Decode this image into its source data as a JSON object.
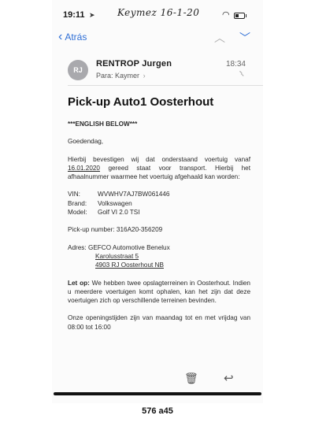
{
  "status_bar": {
    "time": "19:11",
    "handwritten_note": "Keymez 16-1-20",
    "icons": [
      "location-icon",
      "wifi-icon",
      "battery-icon"
    ]
  },
  "nav": {
    "back_label": "Atrás",
    "icons": [
      "chevron-left-icon",
      "chevron-up-icon",
      "chevron-down-icon"
    ]
  },
  "message": {
    "avatar_initials": "RJ",
    "sender": "RENTROP Jurgen",
    "recipient_prefix": "Para:",
    "recipient_name": "Kaymer",
    "time": "18:34",
    "subject": "Pick-up Auto1 Oosterhout",
    "body": {
      "english_below": "***ENGLISH BELOW***",
      "greeting": "Goedendag,",
      "intro_before_date": "Hierbij bevestigen wij dat onderstaand voertuig vanaf",
      "pickup_date": "16.01.2020",
      "intro_after_date": "gereed staat voor transport. Hierbij het afhaalnummer waarmee het voertuig afgehaald kan worden:",
      "vin_label": "VIN:",
      "vin_value": "WVWHV7AJ7BW061446",
      "brand_label": "Brand:",
      "brand_value": "Volkswagen",
      "model_label": "Model:",
      "model_value": "Golf VI 2.0 TSI",
      "pickup_number_label": "Pick-up number:",
      "pickup_number_value": "316A20-356209",
      "address_label": "Adres:",
      "address_line1": "GEFCO Automotive Benelux",
      "address_line2": "Karolusstraat 5",
      "address_line3": "4903 RJ Oosterhout NB",
      "note_label": "Let op:",
      "note_text": "We hebben twee opslagterreinen in Oosterhout. Indien u meerdere voertuigen komt ophalen, kan het zijn dat deze voertuigen zich op verschillende terreinen bevinden.",
      "hours_text": "Onze openingstijden zijn van maandag tot en met vrijdag van 08:00 tot 16:00"
    }
  },
  "toolbar": {
    "icons": [
      "trash-icon",
      "reply-icon"
    ]
  },
  "page_stamp": "576 a45"
}
